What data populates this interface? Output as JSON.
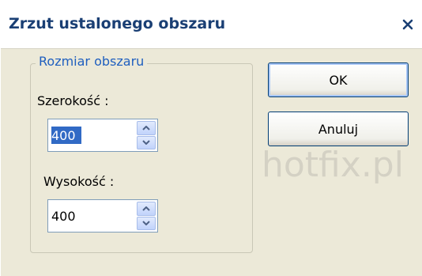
{
  "dialog": {
    "title": "Zrzut ustalonego obszaru",
    "close_icon": "close-icon"
  },
  "group": {
    "legend": "Rozmiar obszaru",
    "width_label": "Szerokość :",
    "width_value": "400",
    "height_label": "Wysokość :",
    "height_value": "400"
  },
  "buttons": {
    "ok_label": "OK",
    "cancel_label": "Anuluj"
  },
  "watermark": {
    "text": "hotfix.pl"
  },
  "colors": {
    "title_text": "#1a3f74",
    "legend_text": "#1f5fbf",
    "dialog_bg": "#ece9d8",
    "selection": "#316ac5"
  }
}
